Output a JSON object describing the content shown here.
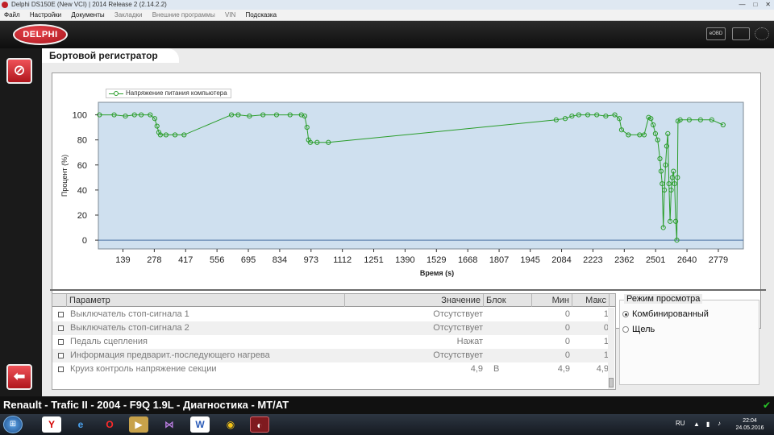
{
  "window": {
    "title": "Delphi DS150E (New VCI) | 2014 Release 2 (2.14.2.2)"
  },
  "menu": [
    {
      "label": "Файл",
      "enabled": true
    },
    {
      "label": "Настройки",
      "enabled": true
    },
    {
      "label": "Документы",
      "enabled": true
    },
    {
      "label": "Закладки",
      "enabled": false
    },
    {
      "label": "Внешние программы",
      "enabled": false
    },
    {
      "label": "VIN",
      "enabled": false
    },
    {
      "label": "Подсказка",
      "enabled": true
    }
  ],
  "header": {
    "logo": "DELPHI",
    "obd_label": "eOBD"
  },
  "panel": {
    "title": "Бортовой регистратор"
  },
  "chart_data": {
    "type": "line",
    "legend": [
      "Напряжение питания компьютера"
    ],
    "legend_position": "top-left",
    "xlabel": "Время (s)",
    "ylabel": "Процент (%)",
    "xlim": [
      30,
      2890
    ],
    "ylim": [
      -7,
      110
    ],
    "grid": false,
    "color": "#2a9d2a",
    "background": "#cfe0ef",
    "x_ticks": [
      139,
      278,
      417,
      556,
      695,
      834,
      973,
      1112,
      1251,
      1390,
      1529,
      1668,
      1807,
      1945,
      2084,
      2223,
      2362,
      2501,
      2640,
      2779
    ],
    "y_ticks": [
      0,
      20,
      40,
      60,
      80,
      100
    ],
    "series": [
      {
        "name": "Напряжение питания компьютера",
        "x": [
          35,
          100,
          150,
          190,
          220,
          260,
          280,
          290,
          298,
          305,
          330,
          370,
          410,
          620,
          650,
          700,
          760,
          820,
          880,
          930,
          945,
          955,
          962,
          970,
          1000,
          1050,
          2060,
          2100,
          2130,
          2160,
          2200,
          2240,
          2280,
          2320,
          2340,
          2350,
          2380,
          2430,
          2450,
          2470,
          2480,
          2490,
          2500,
          2510,
          2520,
          2525,
          2530,
          2535,
          2540,
          2545,
          2550,
          2555,
          2560,
          2565,
          2570,
          2575,
          2580,
          2585,
          2590,
          2595,
          2598,
          2600,
          2610,
          2650,
          2700,
          2750,
          2800
        ],
        "y": [
          100,
          100,
          99,
          100,
          100,
          100,
          97,
          91,
          86,
          84,
          84,
          84,
          84,
          100,
          100,
          99,
          100,
          100,
          100,
          100,
          99,
          90,
          80,
          78,
          78,
          78,
          96,
          97,
          99,
          100,
          100,
          100,
          99,
          100,
          97,
          88,
          84,
          84,
          84,
          98,
          97,
          92,
          85,
          80,
          65,
          55,
          45,
          10,
          40,
          60,
          75,
          85,
          45,
          15,
          40,
          50,
          55,
          45,
          15,
          0,
          50,
          95,
          96,
          96,
          96,
          96,
          92
        ]
      }
    ]
  },
  "table": {
    "columns": [
      "Параметр",
      "Значение",
      "Блок",
      "Мин",
      "Макс"
    ],
    "rows": [
      {
        "name": "Выключатель стоп-сигнала 1",
        "value": "Отсутствует",
        "block": "",
        "min": "0",
        "max": "1"
      },
      {
        "name": "Выключатель стоп-сигнала 2",
        "value": "Отсутствует",
        "block": "",
        "min": "0",
        "max": "0"
      },
      {
        "name": "Педаль сцепления",
        "value": "Нажат",
        "block": "",
        "min": "0",
        "max": "1"
      },
      {
        "name": "Информация предварит.-последующего нагрева",
        "value": "Отсутствует",
        "block": "",
        "min": "0",
        "max": "1"
      },
      {
        "name": "Круиз контроль напряжение секции",
        "value": "4,9",
        "block": "В",
        "min": "4,9",
        "max": "4,9"
      }
    ]
  },
  "view_mode": {
    "title": "Режим просмотра",
    "options": [
      {
        "label": "Комбинированный",
        "selected": true
      },
      {
        "label": "Щель",
        "selected": false
      }
    ]
  },
  "status": {
    "vehicle": "Renault - Trafic II - 2004 - F9Q 1.9L - Диагностика - MT/AT"
  },
  "taskbar": {
    "lang": "RU",
    "time": "22:04",
    "date": "24.05.2016"
  }
}
